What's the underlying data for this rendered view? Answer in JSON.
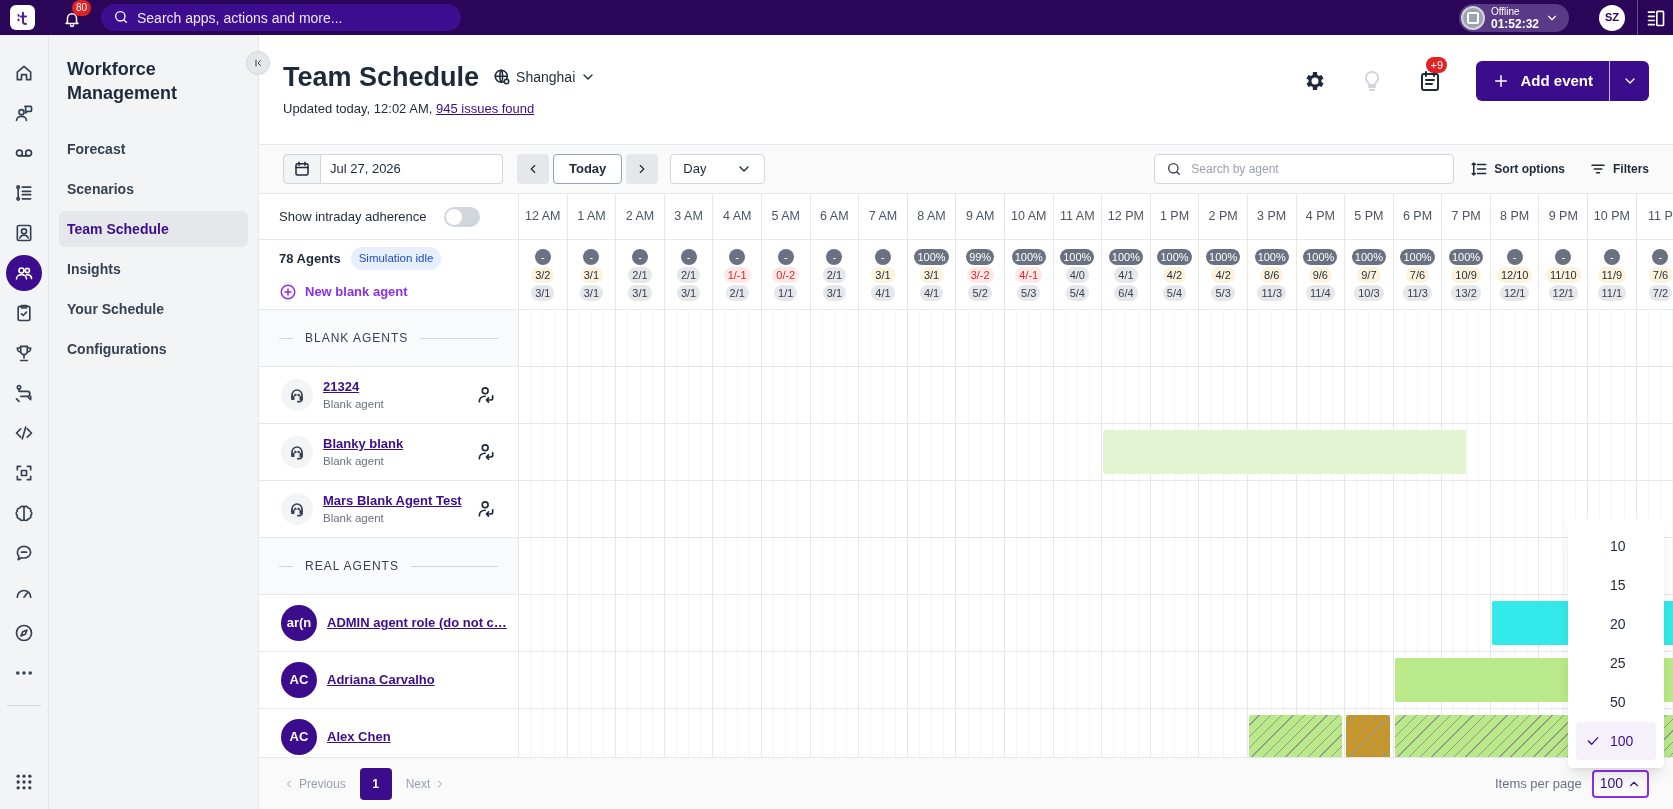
{
  "top_bar": {
    "notifications": "80",
    "search": {
      "placeholder": "Search apps, actions and more..."
    },
    "status": {
      "label": "Offline",
      "timer": "01:52:32"
    },
    "avatar": "SZ"
  },
  "rail": [
    {
      "selected": false
    },
    {
      "selected": false
    },
    {
      "selected": false
    },
    {
      "selected": false
    },
    {
      "selected": false
    },
    {
      "selected": true
    },
    {
      "selected": false
    },
    {
      "selected": false
    },
    {
      "selected": false
    },
    {
      "selected": false
    },
    {
      "selected": false
    },
    {
      "selected": false
    },
    {
      "selected": false
    },
    {
      "selected": false
    },
    {
      "selected": false
    },
    {
      "selected": false
    }
  ],
  "sidebar": {
    "title": "Workforce Management",
    "items": [
      {
        "label": "Forecast",
        "selected": false
      },
      {
        "label": "Scenarios",
        "selected": false
      },
      {
        "label": "Team Schedule",
        "selected": true
      },
      {
        "label": "Insights",
        "selected": false
      },
      {
        "label": "Your Schedule",
        "selected": false
      },
      {
        "label": "Configurations",
        "selected": false
      }
    ]
  },
  "header": {
    "title": "Team Schedule",
    "timezone": "Shanghai",
    "updated": "Updated today, 12:02 AM, ",
    "issues_link": "945 issues found",
    "notes_badge": "+9",
    "add_button": "Add event"
  },
  "toolbar": {
    "date": "Jul 27, 2026",
    "today": "Today",
    "view": "Day",
    "search": {
      "placeholder": "Search by agent"
    },
    "sort": "Sort options",
    "filters": "Filters"
  },
  "adherence": {
    "label": "Show intraday adherence",
    "on": false
  },
  "agents_count": "78 Agents",
  "simulation": "Simulation idle",
  "new_agent": "New blank agent",
  "hours": [
    {
      "label": "12 AM",
      "coverage": "-",
      "staffing": "3/2",
      "kind": "warning",
      "scheduled": "3/1"
    },
    {
      "label": "1 AM",
      "coverage": "-",
      "staffing": "3/1",
      "kind": "warning",
      "scheduled": "3/1"
    },
    {
      "label": "2 AM",
      "coverage": "-",
      "staffing": "2/1",
      "kind": "neutral",
      "scheduled": "3/1"
    },
    {
      "label": "3 AM",
      "coverage": "-",
      "staffing": "2/1",
      "kind": "neutral",
      "scheduled": "3/1"
    },
    {
      "label": "4 AM",
      "coverage": "-",
      "staffing": "1/-1",
      "kind": "error",
      "scheduled": "2/1"
    },
    {
      "label": "5 AM",
      "coverage": "-",
      "staffing": "0/-2",
      "kind": "error",
      "scheduled": "1/1"
    },
    {
      "label": "6 AM",
      "coverage": "-",
      "staffing": "2/1",
      "kind": "neutral",
      "scheduled": "3/1"
    },
    {
      "label": "7 AM",
      "coverage": "-",
      "staffing": "3/1",
      "kind": "warning",
      "scheduled": "4/1"
    },
    {
      "label": "8 AM",
      "coverage": "100%",
      "staffing": "3/1",
      "kind": "warning",
      "scheduled": "4/1"
    },
    {
      "label": "9 AM",
      "coverage": "99%",
      "staffing": "3/-2",
      "kind": "error",
      "scheduled": "5/2"
    },
    {
      "label": "10 AM",
      "coverage": "100%",
      "staffing": "4/-1",
      "kind": "error",
      "scheduled": "5/3"
    },
    {
      "label": "11 AM",
      "coverage": "100%",
      "staffing": "4/0",
      "kind": "neutral",
      "scheduled": "5/4"
    },
    {
      "label": "12 PM",
      "coverage": "100%",
      "staffing": "4/1",
      "kind": "neutral",
      "scheduled": "6/4"
    },
    {
      "label": "1 PM",
      "coverage": "100%",
      "staffing": "4/2",
      "kind": "warning",
      "scheduled": "5/4"
    },
    {
      "label": "2 PM",
      "coverage": "100%",
      "staffing": "4/2",
      "kind": "warning",
      "scheduled": "5/3"
    },
    {
      "label": "3 PM",
      "coverage": "100%",
      "staffing": "8/6",
      "kind": "warning",
      "scheduled": "11/3"
    },
    {
      "label": "4 PM",
      "coverage": "100%",
      "staffing": "9/6",
      "kind": "warning",
      "scheduled": "11/4"
    },
    {
      "label": "5 PM",
      "coverage": "100%",
      "staffing": "9/7",
      "kind": "warning",
      "scheduled": "10/3"
    },
    {
      "label": "6 PM",
      "coverage": "100%",
      "staffing": "7/6",
      "kind": "warning",
      "scheduled": "11/3"
    },
    {
      "label": "7 PM",
      "coverage": "100%",
      "staffing": "10/9",
      "kind": "warning",
      "scheduled": "13/2"
    },
    {
      "label": "8 PM",
      "coverage": "-",
      "staffing": "12/10",
      "kind": "warning",
      "scheduled": "12/1"
    },
    {
      "label": "9 PM",
      "coverage": "-",
      "staffing": "11/10",
      "kind": "warning",
      "scheduled": "12/1"
    },
    {
      "label": "10 PM",
      "coverage": "-",
      "staffing": "11/9",
      "kind": "warning",
      "scheduled": "11/1"
    },
    {
      "label": "11 P",
      "coverage": "-",
      "staffing": "7/6",
      "kind": "warning",
      "scheduled": "7/2"
    }
  ],
  "groups": [
    {
      "title": "BLANK AGENTS",
      "agents": [
        {
          "kind": "blank",
          "name": "21324",
          "subtitle": "Blank agent"
        },
        {
          "kind": "blank",
          "name": "Blanky blank",
          "subtitle": "Blank agent",
          "shifts": [
            {
              "kind": "solid",
              "color": "#e3f4d3"
            }
          ]
        },
        {
          "kind": "blank",
          "name": "Mars Blank Agent Test",
          "subtitle": "Blank agent"
        }
      ]
    },
    {
      "title": "REAL AGENTS",
      "agents": [
        {
          "kind": "real",
          "initials": "ar(n",
          "name": "ADMIN agent role (do not c…",
          "shifts": [
            {
              "kind": "solid",
              "color": "#33e9e9"
            }
          ]
        },
        {
          "kind": "real",
          "initials": "AC",
          "name": "Adriana Carvalho",
          "shifts": [
            {
              "kind": "solid",
              "color": "#b9e988"
            }
          ]
        },
        {
          "kind": "real",
          "initials": "AC",
          "name": "Alex Chen",
          "shifts": [
            {
              "kind": "hatched",
              "color": "#b9e988"
            },
            {
              "kind": "hatched",
              "color": "#c99628"
            },
            {
              "kind": "hatched",
              "color": "#b9e988"
            }
          ]
        }
      ]
    }
  ],
  "pagination": {
    "previous": "Previous",
    "pages": [
      {
        "label": "1",
        "selected": true
      }
    ],
    "next": "Next",
    "items_per_page_label": "Items per page",
    "items_per_page": "100",
    "options": [
      {
        "label": "10",
        "selected": false
      },
      {
        "label": "15",
        "selected": false
      },
      {
        "label": "20",
        "selected": false
      },
      {
        "label": "25",
        "selected": false
      },
      {
        "label": "50",
        "selected": false
      },
      {
        "label": "100",
        "selected": true
      }
    ]
  }
}
